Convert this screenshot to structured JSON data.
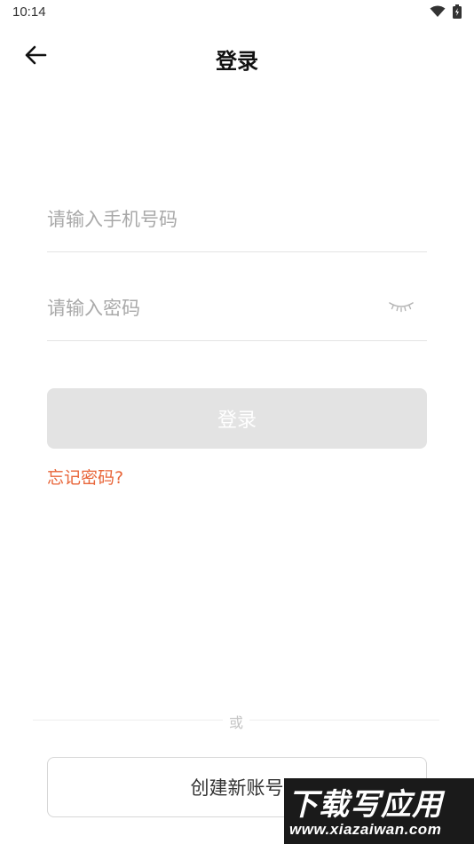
{
  "status_bar": {
    "time": "10:14",
    "icons": [
      "wifi-icon",
      "battery-icon"
    ]
  },
  "nav": {
    "back_icon": "arrow-left-icon",
    "title": "登录"
  },
  "form": {
    "phone_placeholder": "请输入手机号码",
    "phone_value": "",
    "password_placeholder": "请输入密码",
    "password_value": "",
    "eye_icon": "eye-closed-icon",
    "login_label": "登录",
    "forgot_label": "忘记密码?"
  },
  "divider": {
    "label": "或"
  },
  "create_account": {
    "label": "创建新账号"
  },
  "watermark": {
    "main": "下载写应用",
    "sub": "www.xiazaiwan.com"
  },
  "colors": {
    "accent": "#e8663a",
    "login_disabled_bg": "#e3e3e3",
    "placeholder": "#a9a9a9",
    "divider": "#eeeeee"
  }
}
